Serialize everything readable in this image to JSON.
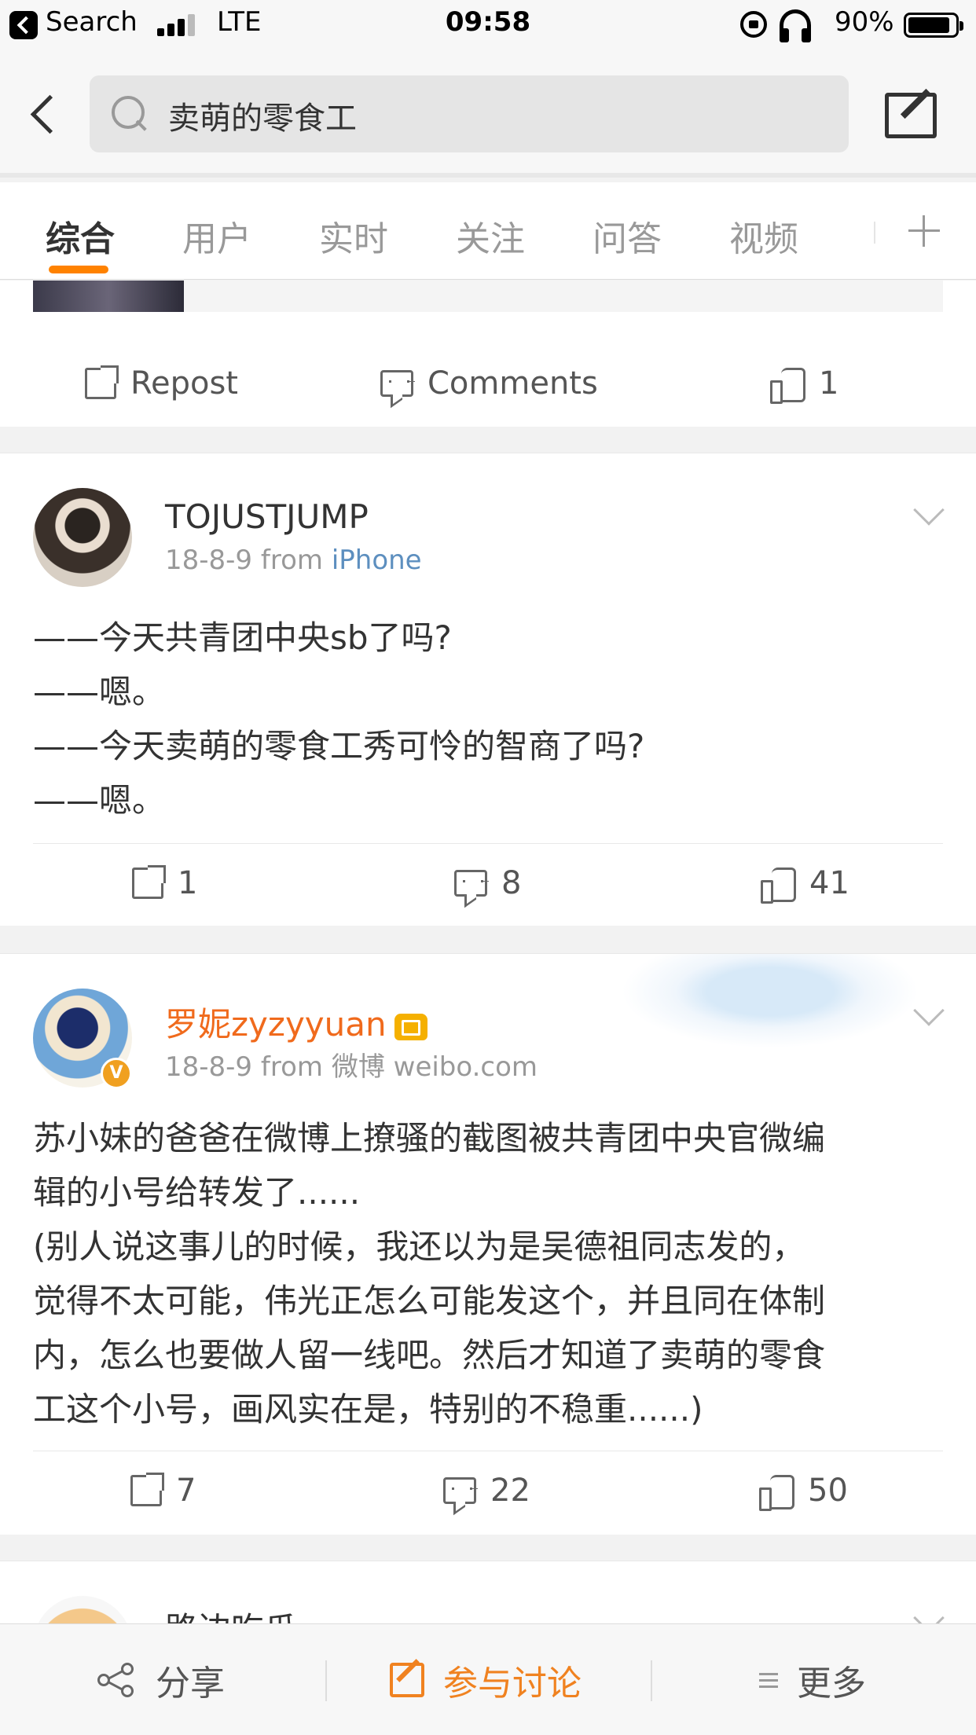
{
  "status_bar": {
    "back_label": "Search",
    "network": "LTE",
    "time": "09:58",
    "battery_pct": "90%",
    "battery_level": 0.9
  },
  "search": {
    "query": "卖萌的零食工"
  },
  "tabs": [
    {
      "label": "综合",
      "active": true
    },
    {
      "label": "用户",
      "active": false
    },
    {
      "label": "实时",
      "active": false
    },
    {
      "label": "关注",
      "active": false
    },
    {
      "label": "问答",
      "active": false
    },
    {
      "label": "视频",
      "active": false
    }
  ],
  "prev_card": {
    "repost_label": "Repost",
    "comments_label": "Comments",
    "likes": "1"
  },
  "posts": [
    {
      "user": "TOJUSTJUMP",
      "date": "18-8-9",
      "from_word": "from",
      "source": "iPhone",
      "lines": [
        "——今天共青团中央sb了吗?",
        "——嗯。",
        "——今天卖萌的零食工秀可怜的智商了吗?",
        "——嗯。"
      ],
      "reposts": "1",
      "comments": "8",
      "likes": "41"
    },
    {
      "user": "罗妮zyzyyuan",
      "date": "18-8-9",
      "from_word": "from",
      "source": "微博 weibo.com",
      "lines": [
        "苏小妹的爸爸在微博上撩骚的截图被共青团中央官微编",
        "辑的小号给转发了......",
        "(别人说这事儿的时候，我还以为是吴德祖同志发的，",
        "觉得不太可能，伟光正怎么可能发这个，并且同在体制",
        "内，怎么也要做人留一线吧。然后才知道了卖萌的零食",
        "工这个小号，画风实在是，特别的不稳重......)"
      ],
      "reposts": "7",
      "comments": "22",
      "likes": "50"
    },
    {
      "user": "路边吃瓜"
    }
  ],
  "bottom_bar": {
    "share": "分享",
    "discuss": "参与讨论",
    "more": "更多"
  },
  "colors": {
    "accent": "#ff8200",
    "link": "#5d8fbf",
    "vip_name": "#f06a1c"
  }
}
